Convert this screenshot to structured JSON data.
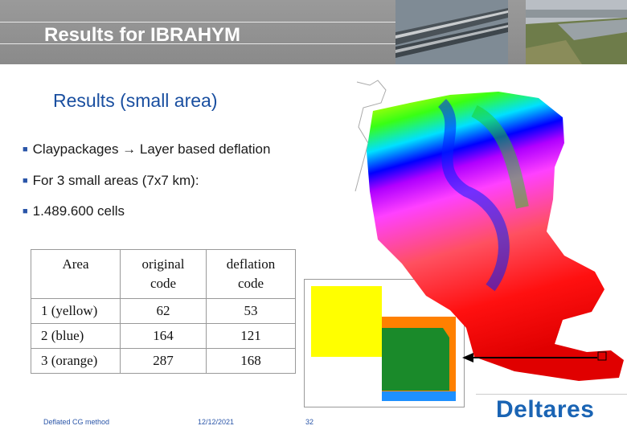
{
  "header": {
    "title": "Results for IBRAHYM"
  },
  "slide": {
    "subtitle": "Results (small area)",
    "bullets": [
      "Claypackages → Layer based deflation",
      "For 3 small areas (7x7 km):",
      "1.489.600 cells"
    ]
  },
  "table": {
    "headers": [
      [
        "Area"
      ],
      [
        "original",
        "code"
      ],
      [
        "deflation",
        "code"
      ]
    ],
    "rows": [
      [
        "1 (yellow)",
        "62",
        "53"
      ],
      [
        "2 (blue)",
        "164",
        "121"
      ],
      [
        "3 (orange)",
        "287",
        "168"
      ]
    ]
  },
  "inset": {
    "colors": {
      "yellow": "#ffff00",
      "orange": "#ff8000",
      "blue": "#1e90ff",
      "green": "#1a8a2a"
    }
  },
  "footer": {
    "left": "Deflated CG method",
    "date": "12/12/2021",
    "page": "32"
  },
  "logo": {
    "text": "Deltares"
  },
  "colors": {
    "accent": "#1a4fa0",
    "logo": "#1a64b4"
  }
}
